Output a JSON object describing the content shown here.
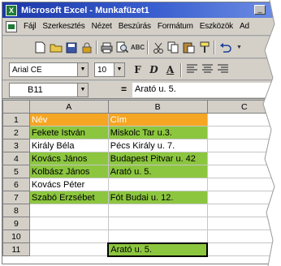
{
  "window": {
    "title": "Microsoft Excel - Munkafüzet1",
    "app_icon": "excel-icon"
  },
  "menu": [
    "Fájl",
    "Szerkesztés",
    "Nézet",
    "Beszúrás",
    "Formátum",
    "Eszközök",
    "Ad"
  ],
  "toolbar": {
    "icons": [
      "new-icon",
      "open-icon",
      "save-icon",
      "permission-icon",
      "print-icon",
      "print-preview-icon",
      "spelling-icon",
      "cut-icon",
      "copy-icon",
      "paste-icon",
      "format-painter-icon",
      "undo-icon"
    ]
  },
  "format": {
    "font": "Arial CE",
    "size": "10",
    "bold": "F",
    "italic": "D",
    "underline": "A"
  },
  "formula_bar": {
    "name_box": "B11",
    "equals": "=",
    "value": "Arató u. 5."
  },
  "sheet": {
    "columns": [
      "A",
      "B",
      "C"
    ],
    "rows": [
      {
        "num": "1",
        "a": "Név",
        "b": "Cím",
        "c": ""
      },
      {
        "num": "2",
        "a": "Fekete István",
        "b": "Miskolc Tar u.3.",
        "c": ""
      },
      {
        "num": "3",
        "a": "Király Béla",
        "b": "Pécs Király u. 7.",
        "c": ""
      },
      {
        "num": "4",
        "a": "Kovács János",
        "b": "Budapest Pitvar u. 42",
        "c": ""
      },
      {
        "num": "5",
        "a": "Kolbász János",
        "b": "Arató u. 5.",
        "c": ""
      },
      {
        "num": "6",
        "a": "Kovács Péter",
        "b": "",
        "c": ""
      },
      {
        "num": "7",
        "a": "Szabó Erzsébet",
        "b": "Fót Budai u. 12.",
        "c": ""
      },
      {
        "num": "8",
        "a": "",
        "b": "",
        "c": ""
      },
      {
        "num": "9",
        "a": "",
        "b": "",
        "c": ""
      },
      {
        "num": "10",
        "a": "",
        "b": "",
        "c": ""
      },
      {
        "num": "11",
        "a": "",
        "b": "Arató u. 5.",
        "c": ""
      }
    ]
  },
  "colors": {
    "header_fill": "#f5a623",
    "row_fill": "#8cc63f"
  }
}
